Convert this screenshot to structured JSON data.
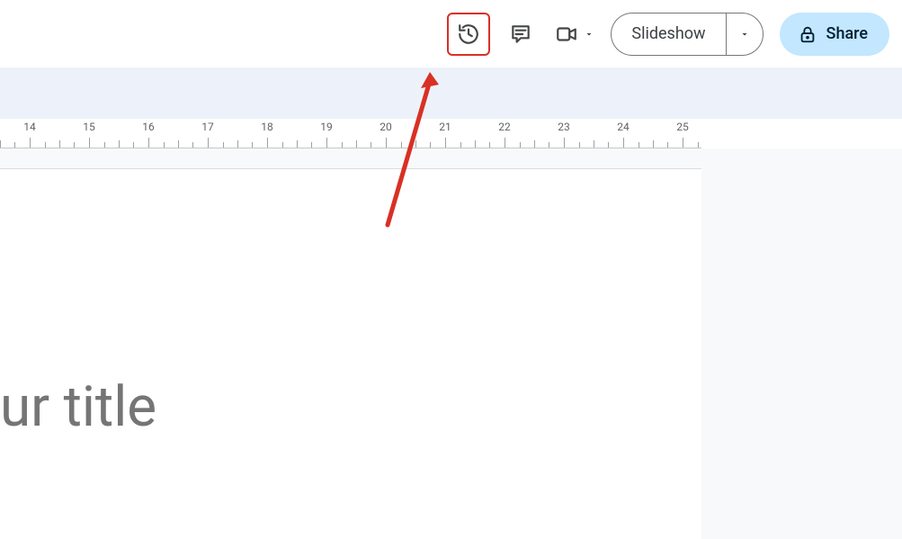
{
  "toolbar": {
    "history_icon": "clock-arrow-icon",
    "comments_icon": "comment-icon",
    "meet_icon": "camera-icon",
    "slideshow_label": "Slideshow",
    "share_label": "Share",
    "share_icon": "lock-icon"
  },
  "ruler": {
    "start": 14,
    "end": 25
  },
  "slide": {
    "title_placeholder": "ur title"
  },
  "annotation": {
    "highlight_target": "history-button",
    "highlight_color": "#d93025"
  }
}
